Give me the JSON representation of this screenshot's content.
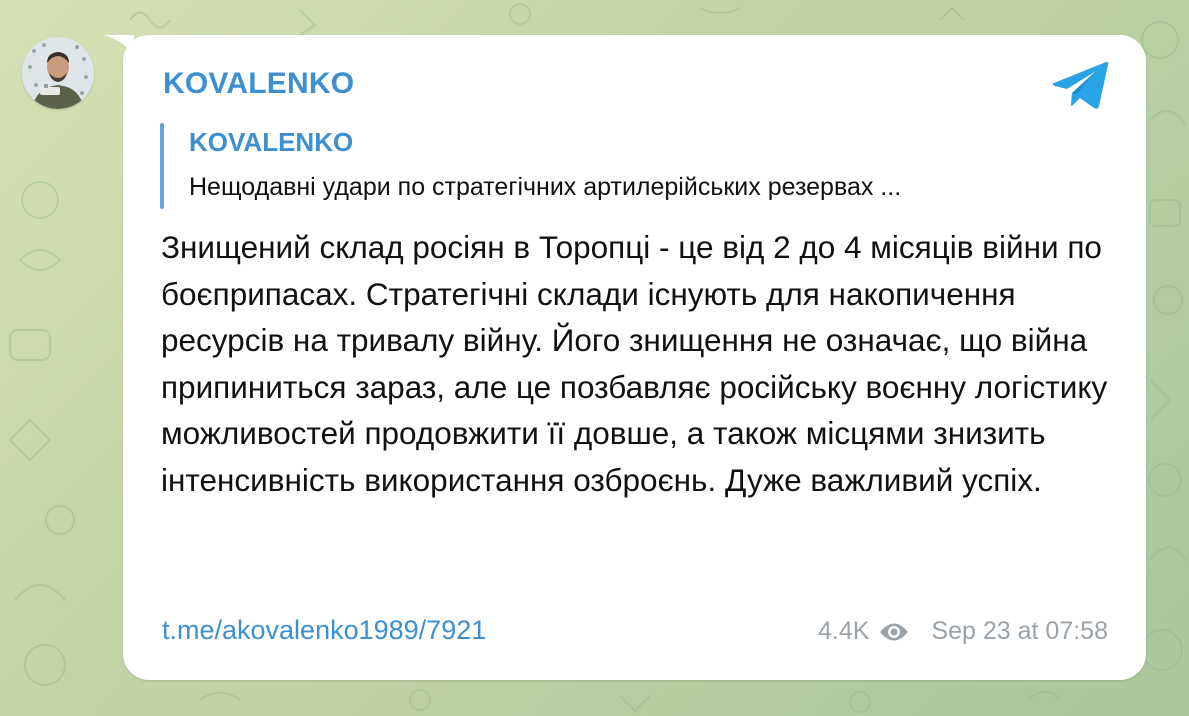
{
  "channel": {
    "name": "KOVALENKO"
  },
  "reply": {
    "name": "KOVALENKO",
    "text": "Нещодавні удари по стратегічних артилерійських резервах ..."
  },
  "message": {
    "text": "Знищений склад росіян в Торопці - це від 2 до 4 місяців війни по боєприпасах. Стратегічні склади існують для накопичення ресурсів на тривалу війну. Його знищення не означає, що війна припиниться зараз, але це позбавляє російську воєнну логістику можливостей продовжити її довше, а також місцями знизить інтенсивність використання озброєнь. Дуже важливий успіх."
  },
  "footer": {
    "link": "t.me/akovalenko1989/7921",
    "views": "4.4K",
    "timestamp": "Sep 23 at 07:58"
  },
  "icons": {
    "brand": "telegram-icon",
    "views": "eye-icon"
  },
  "colors": {
    "accent": "#3e8fd0",
    "reply_bar": "#62a5de",
    "meta_text": "#9aa3aa",
    "bubble": "#ffffff",
    "background": "#c4d5a8"
  }
}
